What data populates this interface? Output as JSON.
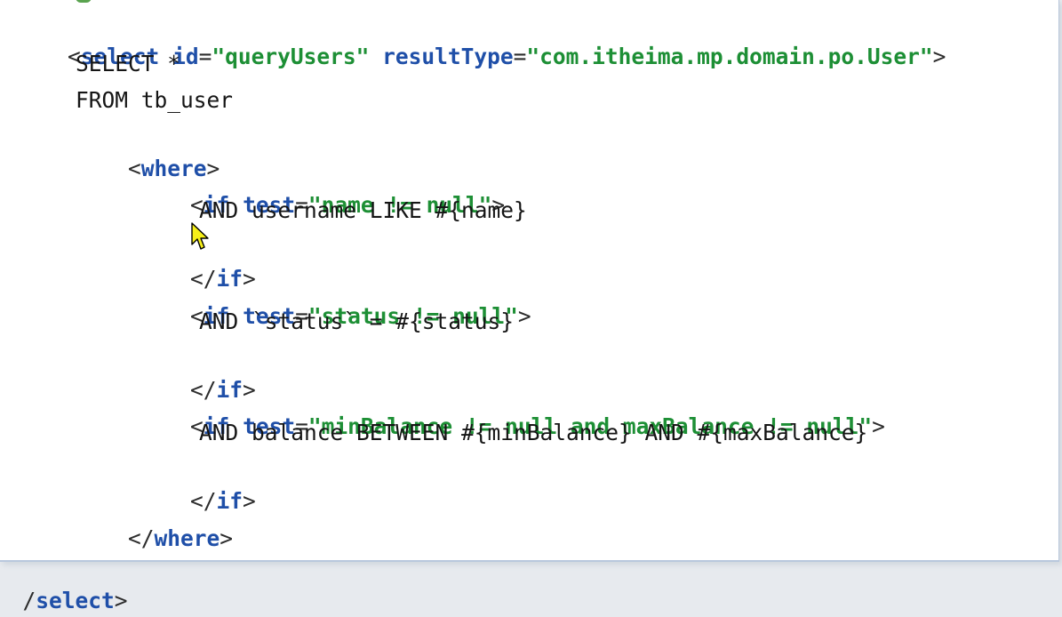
{
  "editor": {
    "lines": [
      {
        "open": "<",
        "tag": "select",
        "space1": " ",
        "attr1": "id",
        "eq1": "=",
        "value1": "\"queryUsers\"",
        "space2": " ",
        "attr2": "resultType",
        "eq2": "=",
        "value2": "\"com.itheima.mp.domain.po.User\"",
        "close": ">"
      },
      {
        "text": "SELECT *"
      },
      {
        "text": "FROM tb_user"
      },
      {
        "open": "<",
        "tag": "where",
        "close": ">"
      },
      {
        "open": "<",
        "tag": "if",
        "space": " ",
        "attr": "test",
        "eq": "=",
        "value": "\"name != null\"",
        "close": ">"
      },
      {
        "text": "AND username LIKE #{name}"
      },
      {
        "open": "</",
        "tag": "if",
        "close": ">"
      },
      {
        "open": "<",
        "tag": "if",
        "space": " ",
        "attr": "test",
        "eq": "=",
        "value": "\"status != null\"",
        "close": ">"
      },
      {
        "text": "AND `status` = #{status}"
      },
      {
        "open": "</",
        "tag": "if",
        "close": ">"
      },
      {
        "open": "<",
        "tag": "if",
        "space": " ",
        "attr": "test",
        "eq": "=",
        "value": "\"minBalance != null and maxBalance != null\"",
        "close": ">"
      },
      {
        "text": "AND balance BETWEEN #{minBalance} AND #{maxBalance}"
      },
      {
        "open": "</",
        "tag": "if",
        "close": ">"
      },
      {
        "open": "</",
        "tag": "where",
        "close": ">"
      },
      {
        "open": "</",
        "tag": "select",
        "close": ">"
      }
    ],
    "bottom_clip": {
      "open": "/",
      "tag": "select",
      "close": ">"
    }
  },
  "colors": {
    "background": "#ffffff",
    "outer_background": "#e7eaee",
    "tag": "#1f4fa8",
    "attribute": "#1f4fa8",
    "attribute_value": "#1d8f35",
    "sql_text": "#151515"
  },
  "icons": {
    "mouse_pointer": "mouse-pointer-icon"
  }
}
